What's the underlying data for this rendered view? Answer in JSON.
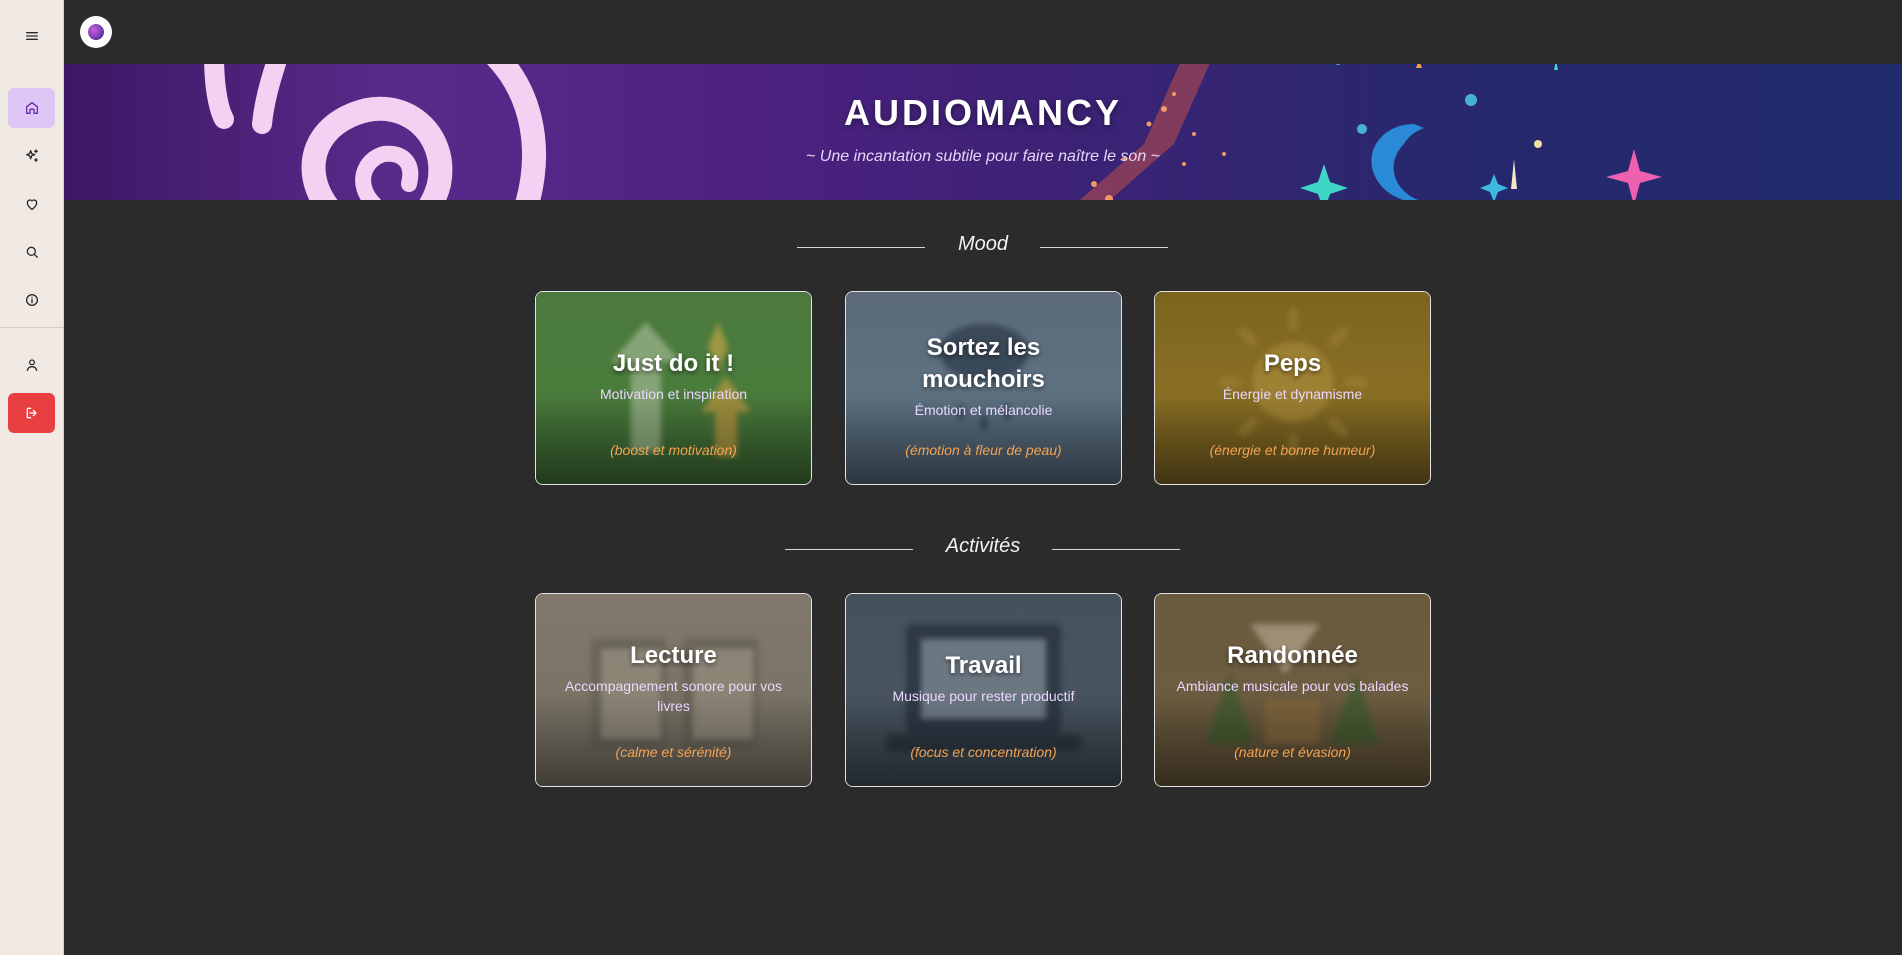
{
  "sidebar": {
    "items": [
      {
        "name": "menu",
        "icon": "hamburger-menu-icon"
      },
      {
        "name": "home",
        "icon": "home-icon",
        "active": true
      },
      {
        "name": "discover",
        "icon": "sparkles-icon"
      },
      {
        "name": "favorites",
        "icon": "heart-icon"
      },
      {
        "name": "search",
        "icon": "search-icon"
      },
      {
        "name": "about",
        "icon": "info-icon"
      },
      {
        "name": "profile",
        "icon": "user-icon"
      },
      {
        "name": "logout",
        "icon": "logout-icon"
      }
    ],
    "accent": "#ddc6f5",
    "logout_color": "#e84040"
  },
  "header": {
    "logo_icon": "audiomancy-logo-icon"
  },
  "banner": {
    "title": "AUDIOMANCY",
    "subtitle": "~ Une incantation subtile pour faire naître le son ~"
  },
  "sections": [
    {
      "label": "Mood",
      "cards": [
        {
          "title": "Just do it !",
          "description": "Motivation et inspiration",
          "tag": "(boost et motivation)",
          "color": "#4a7a3d",
          "art_icon": "arrows-up-icon"
        },
        {
          "title": "Sortez les mouchoirs",
          "description": "Émotion et mélancolie",
          "tag": "(émotion à fleur de peau)",
          "color": "#5c6e80",
          "art_icon": "rain-cloud-icon"
        },
        {
          "title": "Peps",
          "description": "Énergie et dynamisme",
          "tag": "(énergie et bonne humeur)",
          "color": "#8a7020",
          "art_icon": "sun-icon"
        }
      ]
    },
    {
      "label": "Activités",
      "cards": [
        {
          "title": "Lecture",
          "description": "Accompagnement sonore pour vos livres",
          "tag": "(calme et sérénité)",
          "color": "#7c7567",
          "art_icon": "open-book-icon"
        },
        {
          "title": "Travail",
          "description": "Musique pour rester productif",
          "tag": "(focus et concentration)",
          "color": "#45525e",
          "art_icon": "laptop-icon"
        },
        {
          "title": "Randonnée",
          "description": "Ambiance musicale pour vos balades",
          "tag": "(nature et évasion)",
          "color": "#6b5a3e",
          "art_icon": "forest-house-icon"
        }
      ]
    }
  ]
}
